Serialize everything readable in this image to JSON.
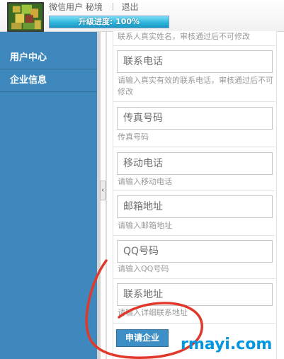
{
  "header": {
    "username": "微信用户 秘境",
    "logout": "退出",
    "progress_label": "升级进度: 100%",
    "progress_fraction": 1.0
  },
  "sidebar": {
    "items": [
      {
        "label": "用户中心"
      },
      {
        "label": "企业信息"
      }
    ],
    "collapse_glyph": "‹"
  },
  "form": {
    "top_hint": "联系人真实姓名，审核通过后不可修改",
    "fields": [
      {
        "placeholder": "联系电话",
        "hint": "请输入真实有效的联系电话，审核通过后不可修改"
      },
      {
        "placeholder": "传真号码",
        "hint": "传真号码"
      },
      {
        "placeholder": "移动电话",
        "hint": "请输入移动电话"
      },
      {
        "placeholder": "邮箱地址",
        "hint": "请输入邮箱地址"
      },
      {
        "placeholder": "QQ号码",
        "hint": "请输入QQ号码"
      },
      {
        "placeholder": "联系地址",
        "hint": "请输入详细联系地址"
      }
    ],
    "submit_label": "申请企业"
  },
  "watermark": "rmayi.com",
  "colors": {
    "sidebar_bg": "#3f88be",
    "button_bg": "#3d8fc5",
    "progress_fill": "#2fb6dc",
    "annotation_red": "#e0392b",
    "watermark": "#0097e0"
  }
}
